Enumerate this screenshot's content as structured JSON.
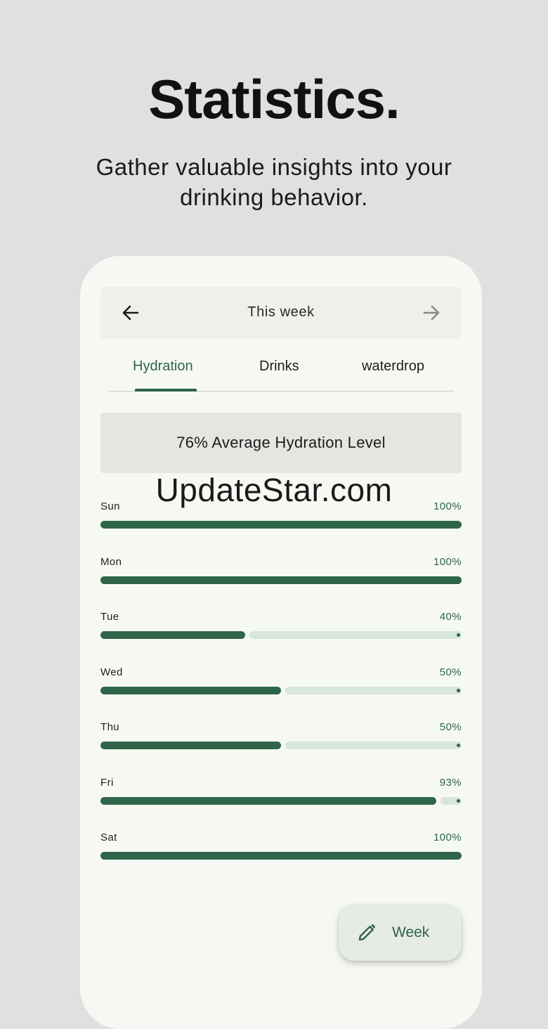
{
  "promo": {
    "title": "Statistics.",
    "subtitle": "Gather valuable insights into your drinking behavior."
  },
  "header": {
    "title": "This week",
    "prev_icon": "arrow-left-icon",
    "next_icon": "arrow-right-icon"
  },
  "tabs": [
    {
      "label": "Hydration",
      "active": true
    },
    {
      "label": "Drinks",
      "active": false
    },
    {
      "label": "waterdrop",
      "active": false
    }
  ],
  "summary": {
    "text": "76% Average Hydration Level"
  },
  "watermark": "UpdateStar.com",
  "days": [
    {
      "label": "Sun",
      "percent_label": "100%",
      "level": 1.0
    },
    {
      "label": "Mon",
      "percent_label": "100%",
      "level": 1.0
    },
    {
      "label": "Tue",
      "percent_label": "40%",
      "level": 0.4
    },
    {
      "label": "Wed",
      "percent_label": "50%",
      "level": 0.5
    },
    {
      "label": "Thu",
      "percent_label": "50%",
      "level": 0.5
    },
    {
      "label": "Fri",
      "percent_label": "93%",
      "level": 0.93
    },
    {
      "label": "Sat",
      "percent_label": "100%",
      "level": 1.0
    }
  ],
  "fab": {
    "label": "Week",
    "icon": "pencil-icon"
  },
  "colors": {
    "accent": "#2d6446",
    "bar_fill": "#2f6548",
    "bar_remaining": "#d7e7db",
    "background": "#e0e0e0",
    "card": "#f6f9f3"
  }
}
